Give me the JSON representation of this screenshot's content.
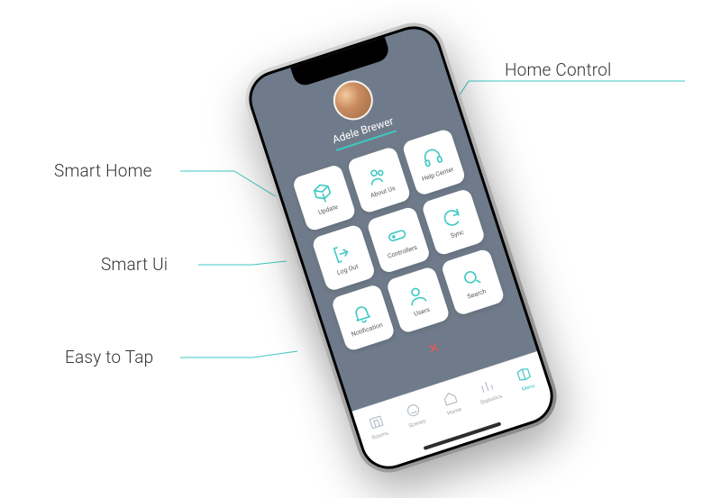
{
  "callouts": {
    "smart_home": "Smart Home",
    "smart_ui": "Smart Ui",
    "easy_to_tap": "Easy to Tap",
    "home_control": "Home Control"
  },
  "user": {
    "name": "Adele Brewer"
  },
  "grid": {
    "items": [
      {
        "label": "Update",
        "icon": "cube-icon"
      },
      {
        "label": "About Us",
        "icon": "team-icon"
      },
      {
        "label": "Help Center",
        "icon": "headset-icon"
      },
      {
        "label": "Log Out",
        "icon": "logout-icon"
      },
      {
        "label": "Controllers",
        "icon": "controller-icon"
      },
      {
        "label": "Sync",
        "icon": "sync-icon"
      },
      {
        "label": "Notification",
        "icon": "bell-icon"
      },
      {
        "label": "Users",
        "icon": "user-icon"
      },
      {
        "label": "Search",
        "icon": "search-icon"
      }
    ]
  },
  "tabs": {
    "items": [
      {
        "label": "Rooms",
        "icon": "rooms-icon",
        "active": false
      },
      {
        "label": "Scenes",
        "icon": "scenes-icon",
        "active": false
      },
      {
        "label": "Home",
        "icon": "home-icon",
        "active": false
      },
      {
        "label": "Statistics",
        "icon": "stats-icon",
        "active": false
      },
      {
        "label": "Menu",
        "icon": "menu-icon",
        "active": true
      }
    ]
  },
  "colors": {
    "accent": "#3ec9c4",
    "screen_bg": "#6f7b8a",
    "close": "#e45a5a"
  }
}
